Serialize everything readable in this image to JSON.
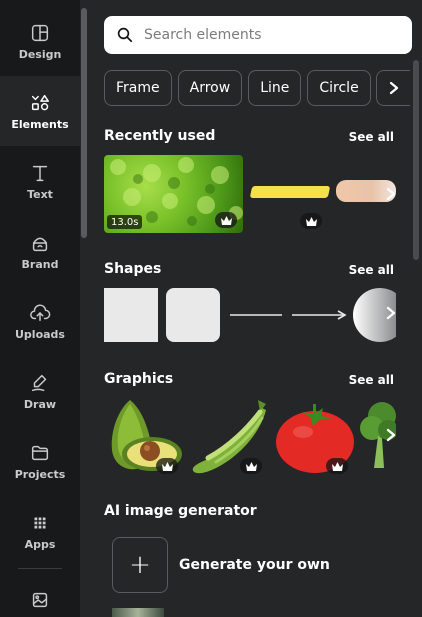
{
  "rail": {
    "items": [
      {
        "label": "Design",
        "icon": "design-icon"
      },
      {
        "label": "Elements",
        "icon": "elements-icon"
      },
      {
        "label": "Text",
        "icon": "text-icon"
      },
      {
        "label": "Brand",
        "icon": "brand-icon"
      },
      {
        "label": "Uploads",
        "icon": "uploads-icon"
      },
      {
        "label": "Draw",
        "icon": "draw-icon"
      },
      {
        "label": "Projects",
        "icon": "projects-icon"
      },
      {
        "label": "Apps",
        "icon": "apps-icon"
      }
    ],
    "active": "Elements"
  },
  "search": {
    "placeholder": "Search elements"
  },
  "chips": [
    "Frame",
    "Arrow",
    "Line",
    "Circle"
  ],
  "sections": {
    "recent": {
      "title": "Recently used",
      "see_all": "See all",
      "video_duration": "13.0s"
    },
    "shapes": {
      "title": "Shapes",
      "see_all": "See all"
    },
    "graphics": {
      "title": "Graphics",
      "see_all": "See all"
    },
    "ai": {
      "title": "AI image generator",
      "action": "Generate your own"
    }
  },
  "colors": {
    "rail_bg": "#18191b",
    "panel_bg": "#252627",
    "chip_border": "#5a5b5e",
    "highlight": "#f5e04a"
  }
}
